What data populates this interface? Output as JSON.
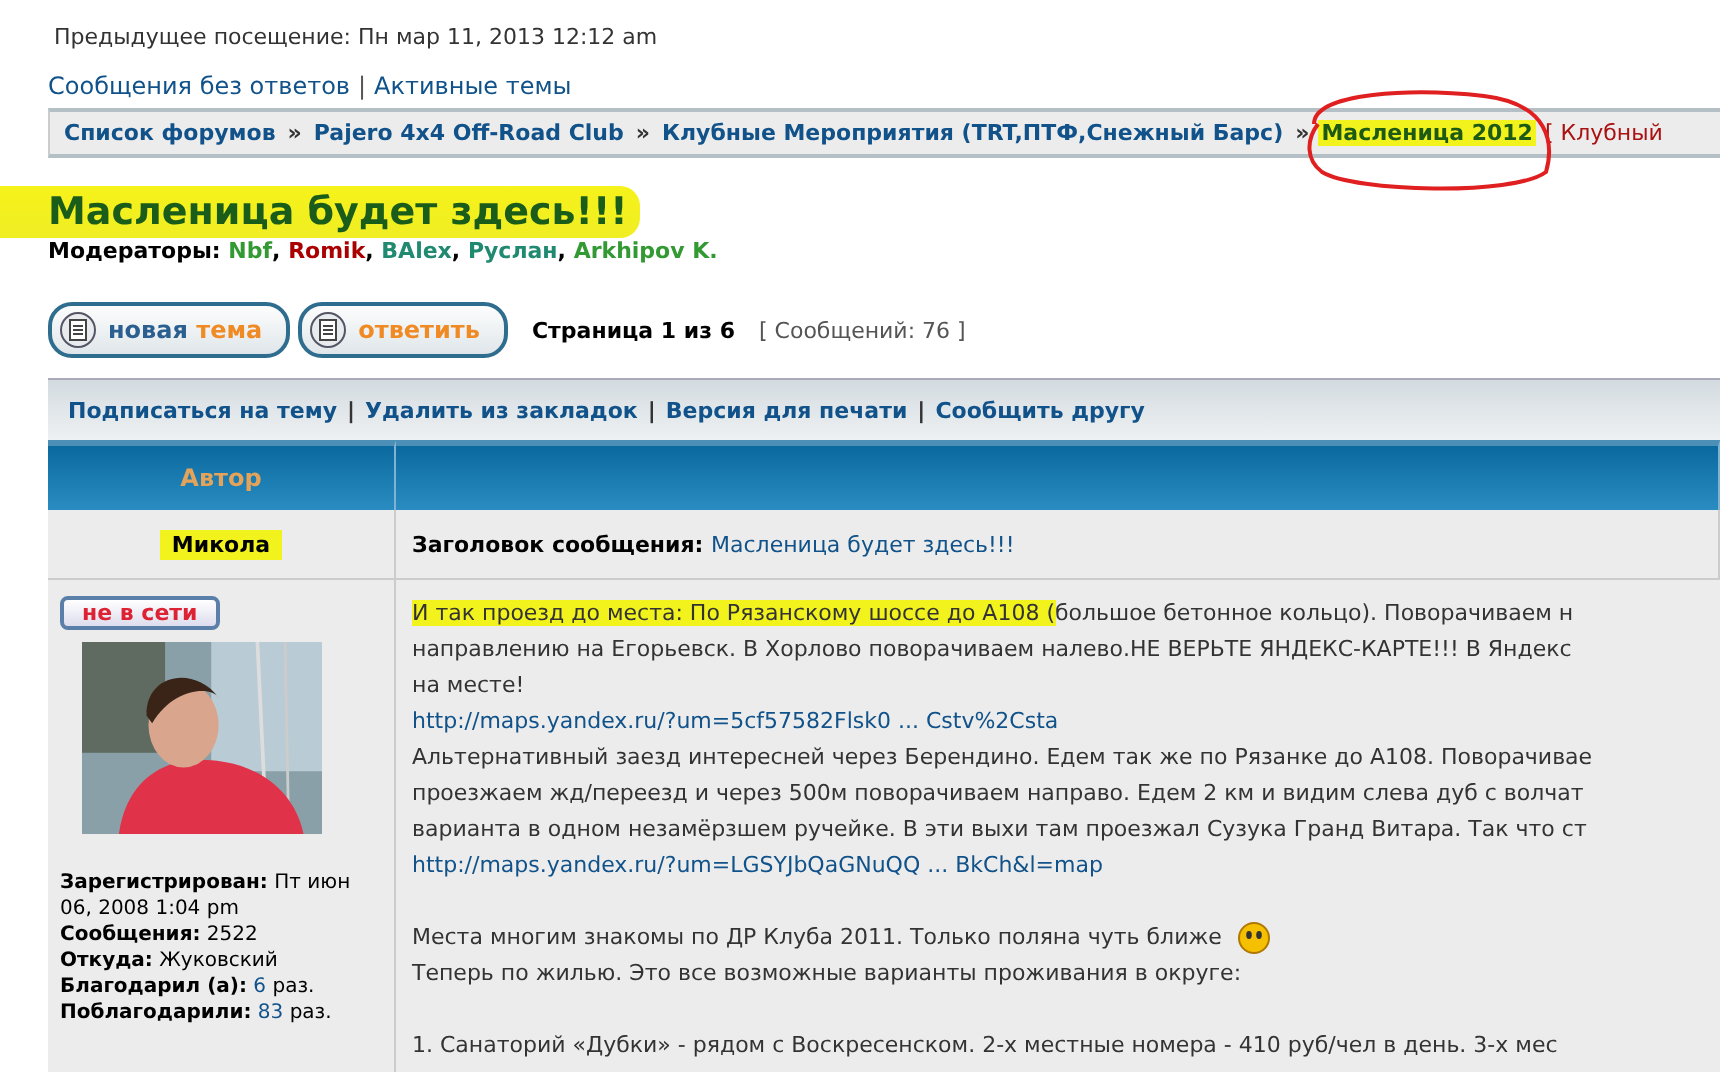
{
  "header": {
    "previous_visit": "Предыдущее посещение: Пн мар 11, 2013 12:12 am",
    "quick_links": [
      "Сообщения без ответов",
      "Активные темы"
    ],
    "separator": "|"
  },
  "breadcrumbs": {
    "items": [
      {
        "label": "Список форумов",
        "current": false,
        "highlighted": false,
        "circled": false
      },
      {
        "label": "Pajero 4x4 Off-Road Club",
        "current": false,
        "highlighted": false,
        "circled": false
      },
      {
        "label": "Клубные Мероприятия (TRT,ПТФ,Снежный Барс)",
        "current": false,
        "highlighted": false,
        "circled": false
      },
      {
        "label": "Масленица 2012",
        "current": true,
        "highlighted": true,
        "circled": true
      }
    ],
    "separator": "»",
    "tail": "[ Клубный"
  },
  "topic": {
    "title": "Масленица будет здесь!!!",
    "highlighted": true,
    "moderators_label": "Модераторы:",
    "separator": ",",
    "moderators": [
      {
        "name": "Nbf",
        "color": "#339933"
      },
      {
        "name": "Romik",
        "color": "#aa0000"
      },
      {
        "name": "BAlex",
        "color": "#1f8a70"
      },
      {
        "name": "Руслан",
        "color": "#1f8a70"
      },
      {
        "name": "Arkhipov K.",
        "color": "#339933"
      }
    ]
  },
  "actions": {
    "buttons": [
      {
        "primary": "новая",
        "secondary": "тема"
      },
      {
        "secondary": "ответить"
      }
    ],
    "pagination": "Страница 1 из 6",
    "post_count": "[ Сообщений: 76 ]"
  },
  "topic_links": {
    "separator": "|",
    "items": [
      "Подписаться на тему",
      "Удалить из закладок",
      "Версия для печати",
      "Сообщить другу"
    ]
  },
  "table": {
    "columns": [
      "Автор"
    ],
    "post": {
      "author": "Микола",
      "author_highlighted": true,
      "subject_label": "Заголовок сообщения:",
      "subject": "Масленица будет здесь!!!",
      "status": "не в сети",
      "profile": [
        {
          "label": "Зарегистрирован:",
          "value": "Пт июн 06, 2008 1:04 pm",
          "kind": "text"
        },
        {
          "label": "Сообщения:",
          "value": "2522",
          "kind": "text"
        },
        {
          "label": "Откуда:",
          "value": "Жуковский",
          "kind": "text"
        },
        {
          "label": "Благодарил (а):",
          "value": "6",
          "suffix": "раз.",
          "kind": "link"
        },
        {
          "label": "Поблагодарили:",
          "value": "83",
          "suffix": "раз.",
          "kind": "link"
        }
      ],
      "body": [
        {
          "kind": "text",
          "highlight": "И так проезд до места: По Рязанскому шоссе до А108 (",
          "text": "большое бетонное кольцо). Поворачиваем н"
        },
        {
          "kind": "text",
          "text": "направлению на Егорьевск. В Хорлово поворачиваем налево.НЕ ВЕРЬТЕ ЯНДЕКС-КАРТЕ!!! В Яндекс"
        },
        {
          "kind": "text",
          "text": "на месте!"
        },
        {
          "kind": "link",
          "text": "http://maps.yandex.ru/?um=5cf57582Flsk0 ... Cstv%2Csta"
        },
        {
          "kind": "text",
          "text": "Альтернативный заезд интересней через Берендино. Едем так же по Рязанке до А108. Поворачивае"
        },
        {
          "kind": "text",
          "text": "проезжаем жд/переезд и через 500м поворачиваем направо. Едем 2 км и видим слева дуб с волчат"
        },
        {
          "kind": "text",
          "text": "варианта в одном незамёрзшем ручейке. В эти выхи там проезжал Сузука Гранд Витара. Так что ст"
        },
        {
          "kind": "link",
          "text": "http://maps.yandex.ru/?um=LGSYJbQaGNuQQ ... BkCh&l=map"
        },
        {
          "kind": "blank"
        },
        {
          "kind": "smiley",
          "text": "Места многим знакомы по ДР Клуба 2011. Только поляна чуть ближе"
        },
        {
          "kind": "text",
          "text": "Теперь по жилью. Это все возможные варианты проживания в округе:"
        },
        {
          "kind": "blank"
        },
        {
          "kind": "text",
          "text": "1. Санаторий «Дубки» - рядом с Воскресенском. 2-х местные номера - 410 руб/чел в день. 3-х мес"
        }
      ]
    }
  }
}
